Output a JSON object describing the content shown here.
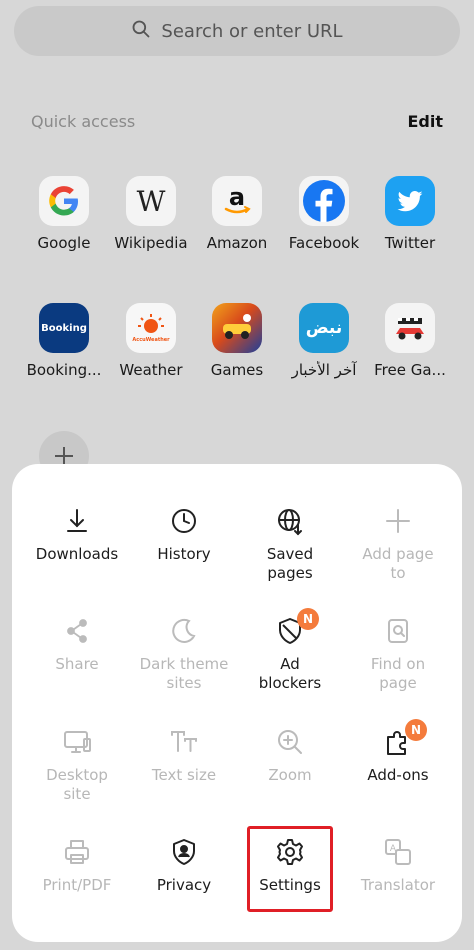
{
  "search": {
    "placeholder": "Search or enter URL"
  },
  "quick_access": {
    "title": "Quick access",
    "edit_label": "Edit",
    "row1": [
      {
        "label": "Google",
        "icon": "google-icon"
      },
      {
        "label": "Wikipedia",
        "icon": "wikipedia-icon"
      },
      {
        "label": "Amazon",
        "icon": "amazon-icon"
      },
      {
        "label": "Facebook",
        "icon": "facebook-icon"
      },
      {
        "label": "Twitter",
        "icon": "twitter-icon"
      }
    ],
    "row2": [
      {
        "label": "Booking...",
        "icon": "booking-icon",
        "icon_text": "Booking"
      },
      {
        "label": "Weather",
        "icon": "accuweather-icon",
        "icon_text": "AccuWeather"
      },
      {
        "label": "Games",
        "icon": "games-icon"
      },
      {
        "label": "آخر الأخبار",
        "icon": "nabd-icon",
        "icon_text": "نبض"
      },
      {
        "label": "Free Ga...",
        "icon": "free-games-icon"
      }
    ]
  },
  "menu": {
    "downloads": "Downloads",
    "history": "History",
    "saved_pages": "Saved pages",
    "add_page_to": "Add page to",
    "share": "Share",
    "dark_theme_sites": "Dark theme sites",
    "ad_blockers": "Ad blockers",
    "find_on_page": "Find on page",
    "desktop_site": "Desktop site",
    "text_size": "Text size",
    "zoom": "Zoom",
    "add_ons": "Add-ons",
    "print_pdf": "Print/PDF",
    "privacy": "Privacy",
    "settings": "Settings",
    "translator": "Translator",
    "badge_text": "N"
  },
  "colors": {
    "badge": "#f47b3c",
    "highlight": "#e01f26",
    "disabled_text": "#b7b7b7"
  }
}
